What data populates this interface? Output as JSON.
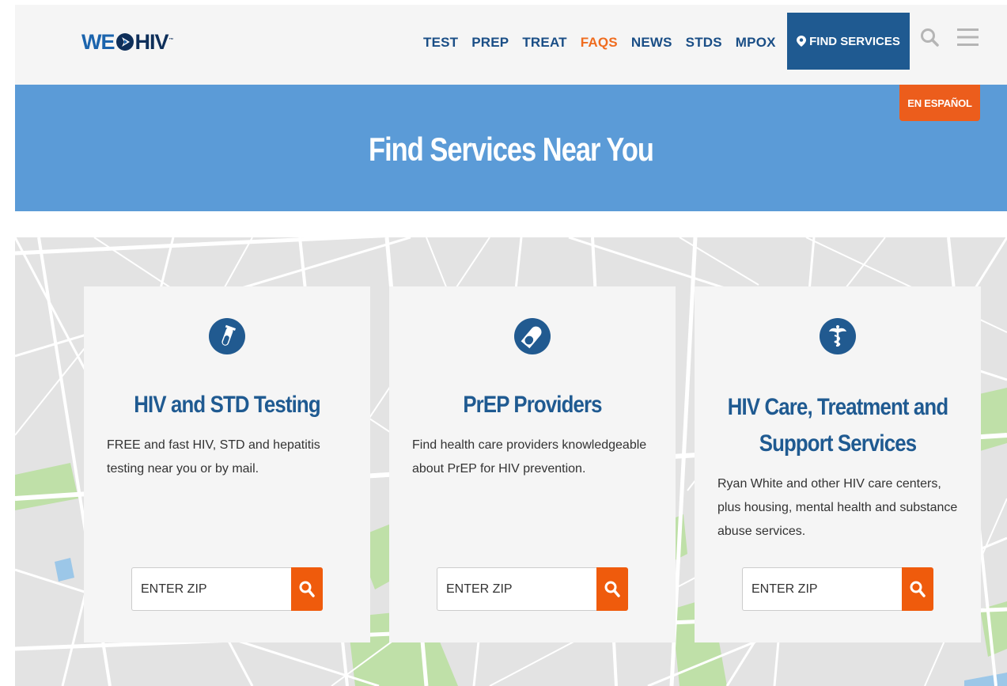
{
  "brand": {
    "logo_we": "WE",
    "logo_hiv": "HIV",
    "logo_tm": "™"
  },
  "nav": {
    "items": [
      {
        "label": "TEST",
        "active": false
      },
      {
        "label": "PREP",
        "active": false
      },
      {
        "label": "TREAT",
        "active": false
      },
      {
        "label": "FAQS",
        "active": true
      },
      {
        "label": "NEWS",
        "active": false
      },
      {
        "label": "STDS",
        "active": false
      },
      {
        "label": "MPOX",
        "active": false
      }
    ],
    "find_services_label": "FIND SERVICES"
  },
  "hero": {
    "title": "Find Services Near You",
    "espanol_label": "EN ESPAÑOL"
  },
  "cards": [
    {
      "title": "HIV and STD Testing",
      "description": "FREE and fast HIV, STD and hepatitis testing near you or by mail.",
      "zip_placeholder": "ENTER ZIP",
      "icon": "test-tube-icon"
    },
    {
      "title": "PrEP Providers",
      "description": "Find health care providers knowledgeable about PrEP for HIV prevention.",
      "zip_placeholder": "ENTER ZIP",
      "icon": "pill-icon"
    },
    {
      "title": "HIV Care, Treatment and Support Services",
      "description": "Ryan White and other HIV care centers, plus housing, mental health and substance abuse services.",
      "zip_placeholder": "ENTER ZIP",
      "icon": "caduceus-icon"
    }
  ],
  "colors": {
    "nav_blue": "#1a4e86",
    "nav_active": "#ef6c1f",
    "find_btn": "#1f5a91",
    "hero_bg": "#5b9bd7",
    "accent_orange": "#ef5b0c"
  }
}
